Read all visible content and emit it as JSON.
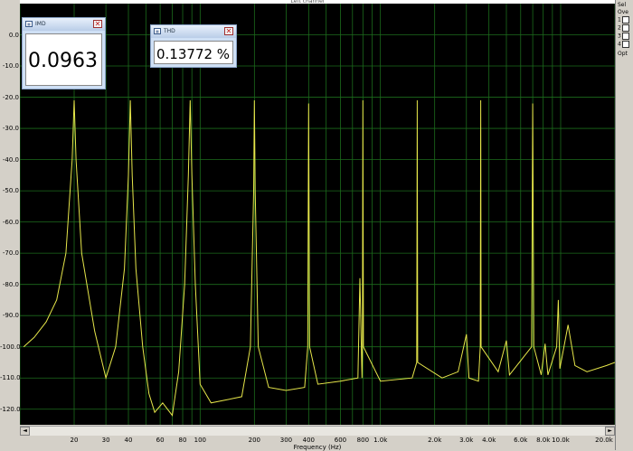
{
  "window": {
    "title": "Left channel"
  },
  "meters": {
    "imd": {
      "label": "IMD",
      "value": "0.0963 %"
    },
    "thd": {
      "label": "THD",
      "value": "0.13772 %"
    }
  },
  "right_panel": {
    "labels": [
      "Sel",
      "Ove",
      "1",
      "2",
      "3",
      "4",
      "Opt"
    ]
  },
  "colors": {
    "trace": "#e6e64a",
    "grid": "#1c6b1c",
    "background": "#000000"
  },
  "chart_data": {
    "type": "line",
    "title": "",
    "xlabel": "Frequency (Hz)",
    "ylabel": "",
    "x_scale": "log",
    "xlim": [
      10,
      20000
    ],
    "ylim": [
      -125,
      10
    ],
    "y_ticks": [
      "0.0",
      "-10.0",
      "-20.0",
      "-30.0",
      "-40.0",
      "-50.0",
      "-60.0",
      "-70.0",
      "-80.0",
      "-90.0",
      "-100.0",
      "-110.0",
      "-120.0"
    ],
    "x_ticks": [
      {
        "v": 20,
        "label": "20"
      },
      {
        "v": 30,
        "label": "30"
      },
      {
        "v": 40,
        "label": "40"
      },
      {
        "v": 60,
        "label": "60"
      },
      {
        "v": 80,
        "label": "80"
      },
      {
        "v": 100,
        "label": "100"
      },
      {
        "v": 200,
        "label": "200"
      },
      {
        "v": 300,
        "label": "300"
      },
      {
        "v": 400,
        "label": "400"
      },
      {
        "v": 600,
        "label": "600"
      },
      {
        "v": 800,
        "label": "800"
      },
      {
        "v": 1000,
        "label": "1.0k"
      },
      {
        "v": 2000,
        "label": "2.0k"
      },
      {
        "v": 3000,
        "label": "3.0k"
      },
      {
        "v": 4000,
        "label": "4.0k"
      },
      {
        "v": 6000,
        "label": "6.0k"
      },
      {
        "v": 8000,
        "label": "8.0k"
      },
      {
        "v": 10000,
        "label": "10.0k"
      },
      {
        "v": 20000,
        "label": "20.0k"
      }
    ],
    "grid": true,
    "series": [
      {
        "points": [
          [
            10.5,
            -100
          ],
          [
            12,
            -97
          ],
          [
            14,
            -92
          ],
          [
            16,
            -85
          ],
          [
            18,
            -70
          ],
          [
            19.5,
            -40
          ],
          [
            20,
            -21
          ],
          [
            20.5,
            -40
          ],
          [
            22,
            -70
          ],
          [
            26,
            -95
          ],
          [
            30,
            -110
          ],
          [
            34,
            -100
          ],
          [
            38,
            -75
          ],
          [
            40,
            -45
          ],
          [
            41,
            -21
          ],
          [
            42,
            -45
          ],
          [
            44,
            -75
          ],
          [
            48,
            -100
          ],
          [
            52,
            -115
          ],
          [
            56,
            -121
          ],
          [
            62,
            -118
          ],
          [
            70,
            -122
          ],
          [
            76,
            -108
          ],
          [
            82,
            -80
          ],
          [
            86,
            -45
          ],
          [
            88,
            -21
          ],
          [
            90,
            -45
          ],
          [
            94,
            -80
          ],
          [
            100,
            -112
          ],
          [
            115,
            -118
          ],
          [
            140,
            -117
          ],
          [
            170,
            -116
          ],
          [
            190,
            -100
          ],
          [
            198,
            -50
          ],
          [
            200,
            -21
          ],
          [
            202,
            -50
          ],
          [
            210,
            -100
          ],
          [
            240,
            -113
          ],
          [
            300,
            -114
          ],
          [
            380,
            -113
          ],
          [
            395,
            -100
          ],
          [
            400,
            -22
          ],
          [
            405,
            -100
          ],
          [
            450,
            -112
          ],
          [
            600,
            -111
          ],
          [
            750,
            -110
          ],
          [
            770,
            -78
          ],
          [
            790,
            -110
          ],
          [
            795,
            -100
          ],
          [
            800,
            -21
          ],
          [
            805,
            -100
          ],
          [
            1000,
            -111
          ],
          [
            1500,
            -110
          ],
          [
            1590,
            -105
          ],
          [
            1600,
            -21
          ],
          [
            1610,
            -105
          ],
          [
            2200,
            -110
          ],
          [
            2700,
            -108
          ],
          [
            3000,
            -96
          ],
          [
            3100,
            -110
          ],
          [
            3500,
            -111
          ],
          [
            3580,
            -100
          ],
          [
            3600,
            -21
          ],
          [
            3620,
            -100
          ],
          [
            4500,
            -108
          ],
          [
            5000,
            -98
          ],
          [
            5200,
            -109
          ],
          [
            6900,
            -100
          ],
          [
            7000,
            -22
          ],
          [
            7100,
            -100
          ],
          [
            7800,
            -109
          ],
          [
            8200,
            -99
          ],
          [
            8500,
            -109
          ],
          [
            9500,
            -100
          ],
          [
            9700,
            -85
          ],
          [
            9900,
            -107
          ],
          [
            11000,
            -93
          ],
          [
            12000,
            -106
          ],
          [
            14000,
            -108
          ],
          [
            18000,
            -106
          ],
          [
            20000,
            -105
          ]
        ]
      }
    ]
  }
}
